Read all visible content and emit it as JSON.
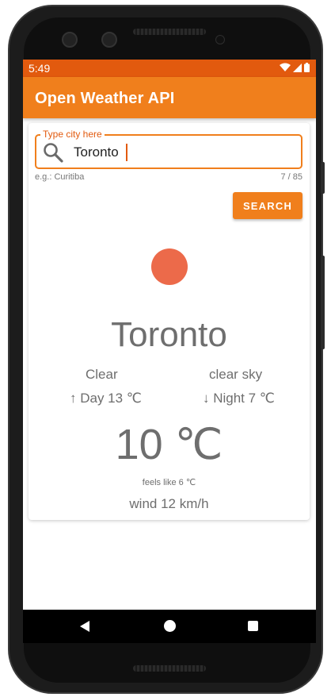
{
  "status_bar": {
    "time": "5:49"
  },
  "app_bar": {
    "title": "Open Weather API"
  },
  "search": {
    "label": "Type city here",
    "value": "Toronto",
    "helper": "e.g.: Curitiba",
    "counter": "7 / 85",
    "button_label": "SEARCH",
    "icon": "search-icon"
  },
  "weather": {
    "icon_color": "#ec6a4a",
    "city": "Toronto",
    "condition": "Clear",
    "description": "clear sky",
    "day_temp": "↑ Day 13 ℃",
    "night_temp": "↓ Night 7 ℃",
    "temperature": "10 ℃",
    "feels_like": "feels like 6 ℃",
    "wind": "wind 12 km/h"
  },
  "navigation": {
    "back_icon": "back-icon",
    "home_icon": "home-icon",
    "recents_icon": "recents-icon"
  },
  "colors": {
    "accent": "#f07f1c",
    "status_bar": "#e25a0e"
  }
}
